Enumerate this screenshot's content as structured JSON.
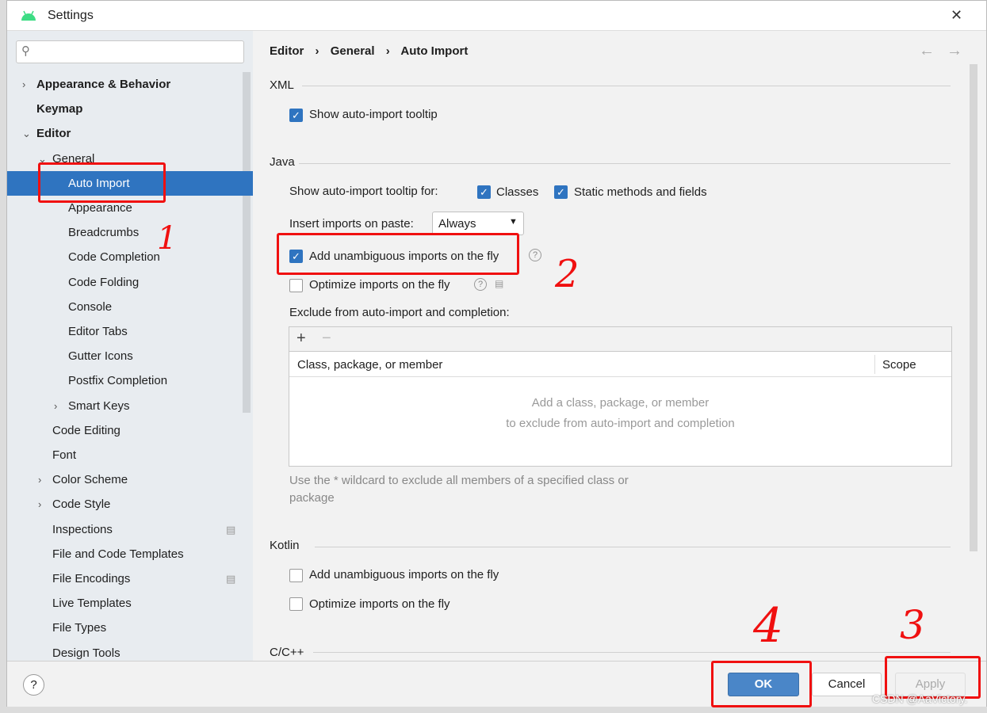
{
  "window": {
    "title": "Settings",
    "close": "✕"
  },
  "search": {
    "placeholder": ""
  },
  "sidebar": {
    "items": [
      {
        "label": "Appearance & Behavior",
        "bold": true,
        "chevron": "›"
      },
      {
        "label": "Keymap",
        "bold": true
      },
      {
        "label": "Editor",
        "bold": true,
        "chevron": "⌄"
      },
      {
        "label": "General",
        "chevron": "⌄"
      },
      {
        "label": "Auto Import",
        "selected": true
      },
      {
        "label": "Appearance"
      },
      {
        "label": "Breadcrumbs"
      },
      {
        "label": "Code Completion"
      },
      {
        "label": "Code Folding"
      },
      {
        "label": "Console"
      },
      {
        "label": "Editor Tabs"
      },
      {
        "label": "Gutter Icons"
      },
      {
        "label": "Postfix Completion"
      },
      {
        "label": "Smart Keys",
        "chevron": "›"
      },
      {
        "label": "Code Editing"
      },
      {
        "label": "Font"
      },
      {
        "label": "Color Scheme",
        "chevron": "›"
      },
      {
        "label": "Code Style",
        "chevron": "›"
      },
      {
        "label": "Inspections",
        "badge": true
      },
      {
        "label": "File and Code Templates"
      },
      {
        "label": "File Encodings",
        "badge": true
      },
      {
        "label": "Live Templates"
      },
      {
        "label": "File Types"
      },
      {
        "label": "Design Tools"
      }
    ]
  },
  "breadcrumb": {
    "items": [
      "Editor",
      "General",
      "Auto Import"
    ],
    "sep": "›",
    "back": "←",
    "forward": "→"
  },
  "xml": {
    "header": "XML",
    "show_tooltip": {
      "label": "Show auto-import tooltip",
      "checked": true
    }
  },
  "java": {
    "header": "Java",
    "tooltip_for": "Show auto-import tooltip for:",
    "classes": {
      "label": "Classes",
      "checked": true
    },
    "static": {
      "label": "Static methods and fields",
      "checked": true
    },
    "insert_label": "Insert imports on paste:",
    "insert_value": "Always",
    "add_unambiguous": {
      "label": "Add unambiguous imports on the fly",
      "checked": true
    },
    "optimize": {
      "label": "Optimize imports on the fly",
      "checked": false
    },
    "exclude_label": "Exclude from auto-import and completion:",
    "table": {
      "add": "+",
      "remove": "−",
      "col1": "Class, package, or member",
      "col2": "Scope",
      "empty1": "Add a class, package, or member",
      "empty2": "to exclude from auto-import and completion"
    },
    "hint1": "Use the * wildcard to exclude all members of a specified class or",
    "hint2": "package"
  },
  "kotlin": {
    "header": "Kotlin",
    "add_unambiguous": {
      "label": "Add unambiguous imports on the fly",
      "checked": false
    },
    "optimize": {
      "label": "Optimize imports on the fly",
      "checked": false
    }
  },
  "cpp": {
    "header": "C/C++"
  },
  "footer": {
    "help": "?",
    "ok": "OK",
    "cancel": "Cancel",
    "apply": "Apply"
  },
  "annotations": [
    "1",
    "2",
    "3",
    "4"
  ],
  "watermark": "CSDN @AaVictory."
}
